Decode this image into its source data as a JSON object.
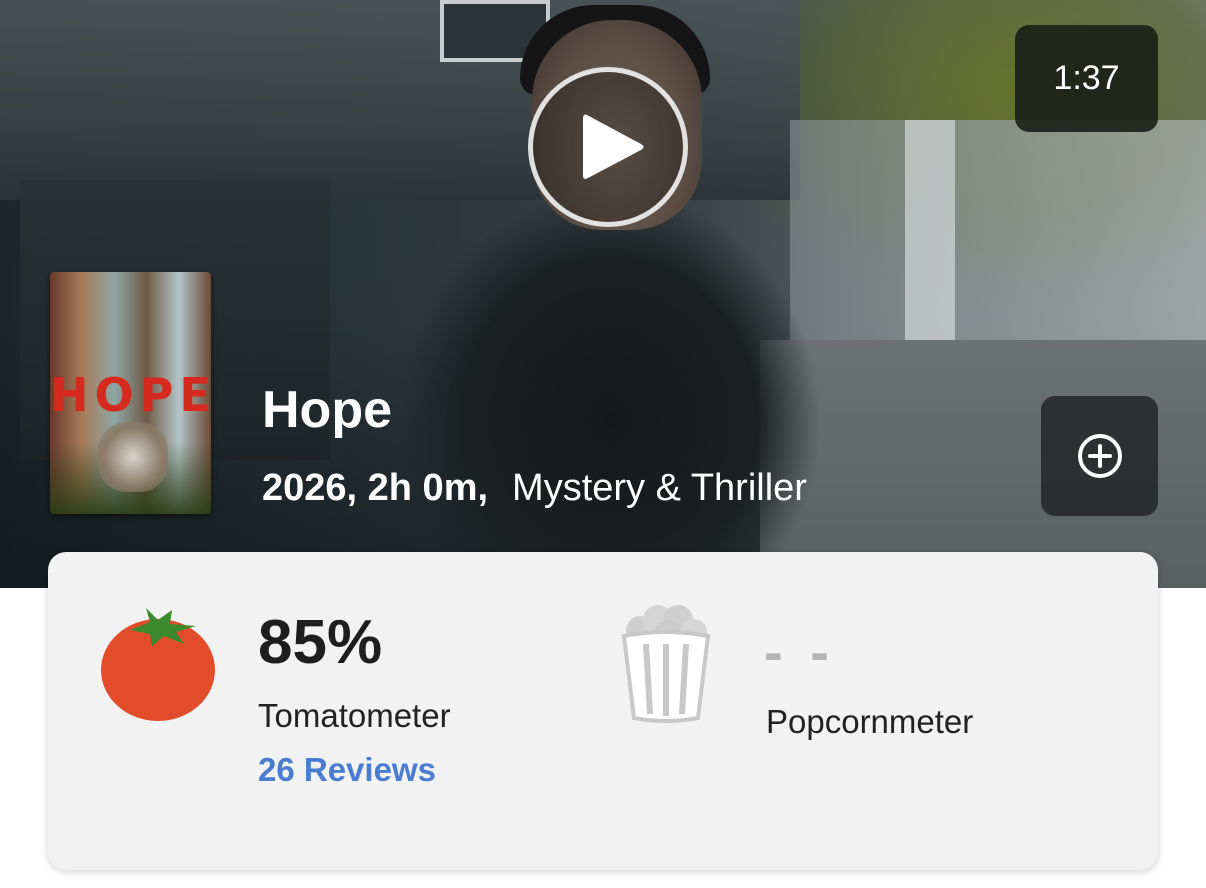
{
  "hero": {
    "duration": "1:37",
    "play_icon": "play-icon",
    "add_icon": "plus-circle-icon"
  },
  "poster": {
    "title_text": "HOPE"
  },
  "movie": {
    "title": "Hope",
    "year_runtime": "2026, 2h 0m,",
    "genre": "Mystery & Thriller"
  },
  "scores": {
    "tomatometer": {
      "value": "85%",
      "label": "Tomatometer",
      "reviews": "26 Reviews",
      "icon": "tomato-icon"
    },
    "popcornmeter": {
      "value": "- -",
      "label": "Popcornmeter",
      "icon": "popcorn-bucket-icon"
    }
  },
  "colors": {
    "link": "#4a7dd1",
    "tomato_red": "#e24c2a",
    "tomato_green": "#3c8a2e",
    "card_bg": "#f2f2f2",
    "empty_score": "#b4b4b4"
  }
}
